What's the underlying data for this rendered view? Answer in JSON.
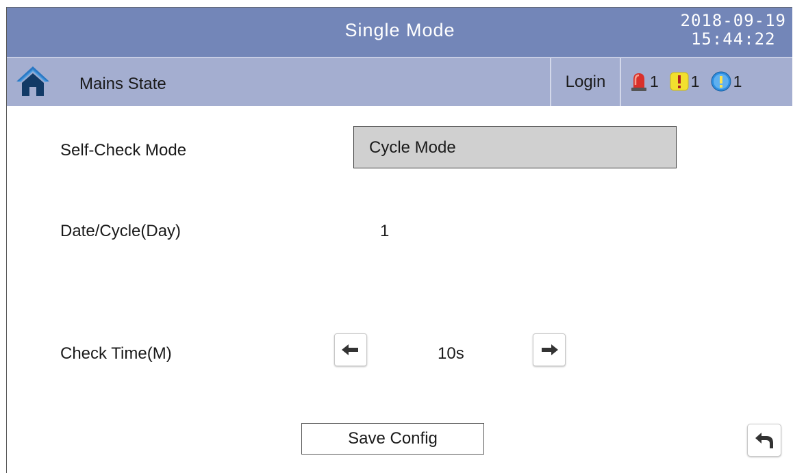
{
  "header": {
    "title": "Single Mode",
    "date": "2018-09-19",
    "time": "15:44:22"
  },
  "statusbar": {
    "page_label": "Mains State",
    "home_icon": "home-icon",
    "login_label": "Login",
    "alarms": [
      {
        "icon": "siren-icon",
        "count": "1",
        "color": "#d9302a"
      },
      {
        "icon": "warning-icon",
        "count": "1",
        "color": "#f2e02e"
      },
      {
        "icon": "info-icon",
        "count": "1",
        "color": "#2d8ee0"
      }
    ]
  },
  "form": {
    "self_check_label": "Self-Check Mode",
    "self_check_value": "Cycle Mode",
    "date_cycle_label": "Date/Cycle(Day)",
    "date_cycle_value": "1",
    "check_time_label": "Check Time(M)",
    "check_time_value": "10s",
    "decrease_icon": "arrow-left-icon",
    "increase_icon": "arrow-right-icon"
  },
  "footer": {
    "save_label": "Save Config",
    "back_icon": "return-icon"
  },
  "colors": {
    "title_bar": "#7386b8",
    "status_bar": "#a4aed0",
    "field_bg": "#d0d0d0"
  }
}
